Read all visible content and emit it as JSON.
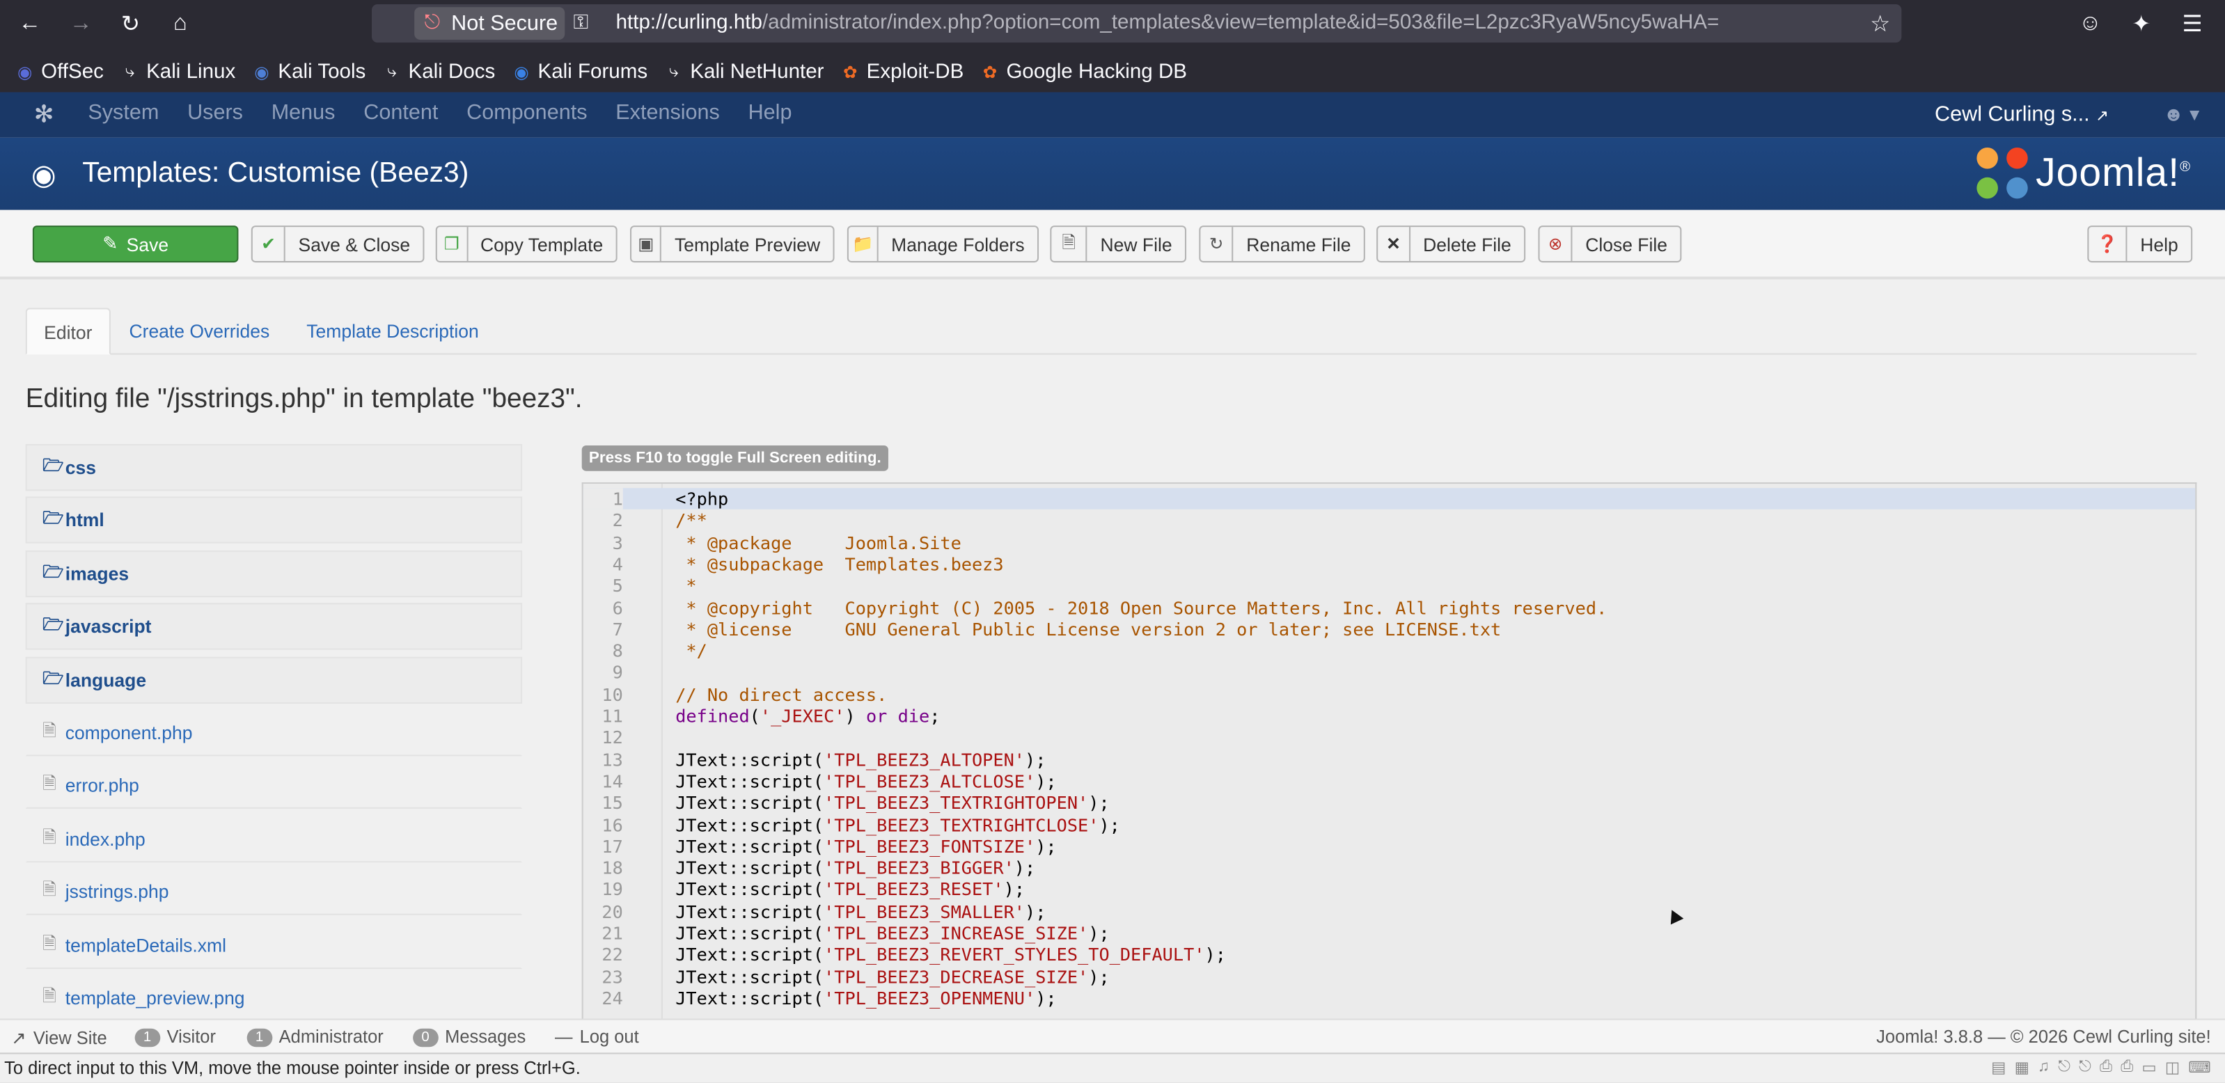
{
  "browser": {
    "not_secure_label": "Not Secure",
    "url_host": "http://curling.htb",
    "url_path": "/administrator/index.php?option=com_templates&view=template&id=503&file=L2pzc3RyaW5ncy5waHA=",
    "bookmarks": [
      {
        "label": "OffSec",
        "icon": "offsec-icon"
      },
      {
        "label": "Kali Linux",
        "icon": "kali-dragon-icon"
      },
      {
        "label": "Kali Tools",
        "icon": "kali-tools-icon"
      },
      {
        "label": "Kali Docs",
        "icon": "kali-dragon-icon"
      },
      {
        "label": "Kali Forums",
        "icon": "kali-forums-icon"
      },
      {
        "label": "Kali NetHunter",
        "icon": "kali-dragon-icon"
      },
      {
        "label": "Exploit-DB",
        "icon": "exploitdb-icon"
      },
      {
        "label": "Google Hacking DB",
        "icon": "ghdb-icon"
      }
    ]
  },
  "admin_nav": {
    "menu": [
      "System",
      "Users",
      "Menus",
      "Content",
      "Components",
      "Extensions",
      "Help"
    ],
    "site_link": "Cewl Curling s..."
  },
  "header": {
    "title": "Templates: Customise (Beez3)",
    "logo_text": "Joomla!"
  },
  "toolbar": {
    "save": "Save",
    "save_close": "Save & Close",
    "copy_template": "Copy Template",
    "template_preview": "Template Preview",
    "manage_folders": "Manage Folders",
    "new_file": "New File",
    "rename_file": "Rename File",
    "delete_file": "Delete File",
    "close_file": "Close File",
    "help": "Help"
  },
  "tabs": [
    "Editor",
    "Create Overrides",
    "Template Description"
  ],
  "editing_label": "Editing file \"/jsstrings.php\" in template \"beez3\".",
  "tree": {
    "folders": [
      "css",
      "html",
      "images",
      "javascript",
      "language"
    ],
    "files": [
      "component.php",
      "error.php",
      "index.php",
      "jsstrings.php",
      "templateDetails.xml",
      "template_preview.png"
    ]
  },
  "editor": {
    "fullscreen_hint": "Press F10 to toggle Full Screen editing."
  },
  "status": {
    "view_site": "View Site",
    "visitors_count": "1",
    "visitors_label": "Visitor",
    "admins_count": "1",
    "admins_label": "Administrator",
    "messages_count": "0",
    "messages_label": "Messages",
    "logout": "Log out",
    "version": "Joomla! 3.8.8",
    "copyright": "— © 2026 Cewl Curling site!"
  },
  "vm_hint": "To direct input to this VM, move the mouse pointer inside or press Ctrl+G.",
  "colors": {
    "joomla_nav": "#1a3867",
    "joomla_header": "#1e4680",
    "save_green": "#46a546",
    "link_blue": "#2a69b8",
    "code_comment": "#a85400",
    "code_string": "#aa1111"
  }
}
